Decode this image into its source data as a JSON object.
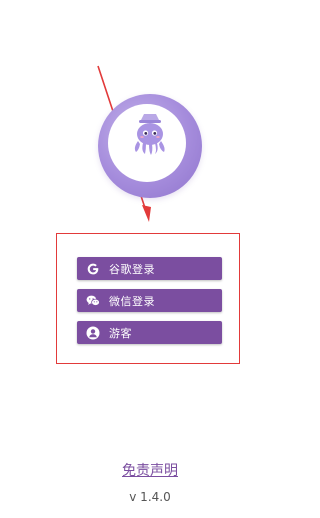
{
  "login": {
    "google_label": "谷歌登录",
    "wechat_label": "微信登录",
    "guest_label": "游客"
  },
  "footer": {
    "disclaimer": "免责声明",
    "version": "v 1.4.0"
  },
  "icons": {
    "google": "google-icon",
    "wechat": "wechat-icon",
    "guest": "user-icon",
    "logo": "octopus-mascot"
  },
  "colors": {
    "accent": "#7b4ea0",
    "highlight_box": "#e23a3a",
    "logo_ring": "#a58cdc"
  }
}
